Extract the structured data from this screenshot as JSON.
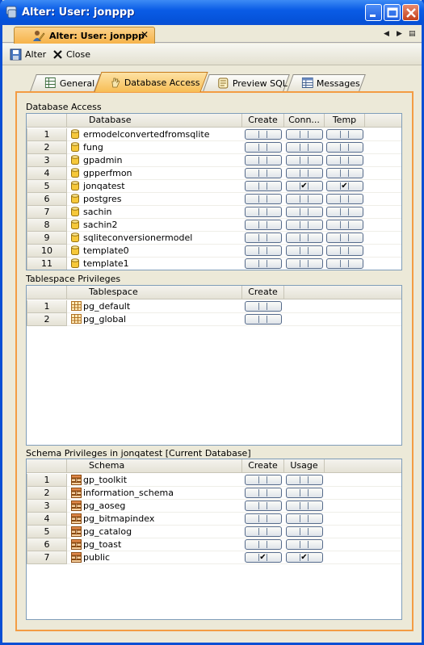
{
  "window": {
    "title": "Alter: User: jonppp"
  },
  "doc_tab": {
    "label": "Alter: User: jonppp",
    "close": "✕"
  },
  "toolbar": {
    "alter_label": "Alter",
    "close_label": "Close"
  },
  "tabs": [
    {
      "label": "General",
      "icon": "grid-icon"
    },
    {
      "label": "Database Access",
      "icon": "hand-icon",
      "active": true
    },
    {
      "label": "Preview SQL",
      "icon": "script-icon"
    },
    {
      "label": "Messages",
      "icon": "table-icon"
    }
  ],
  "database_access": {
    "title": "Database Access",
    "columns": [
      "Database",
      "Create",
      "Conn...",
      "Temp"
    ],
    "rows": [
      {
        "num": "1",
        "name": "ermodelconvertedfromsqlite",
        "create": false,
        "conn": false,
        "temp": false
      },
      {
        "num": "2",
        "name": "fung",
        "create": false,
        "conn": false,
        "temp": false
      },
      {
        "num": "3",
        "name": "gpadmin",
        "create": false,
        "conn": false,
        "temp": false
      },
      {
        "num": "4",
        "name": "gpperfmon",
        "create": false,
        "conn": false,
        "temp": false
      },
      {
        "num": "5",
        "name": "jonqatest",
        "create": false,
        "conn": true,
        "temp": true
      },
      {
        "num": "6",
        "name": "postgres",
        "create": false,
        "conn": false,
        "temp": false
      },
      {
        "num": "7",
        "name": "sachin",
        "create": false,
        "conn": false,
        "temp": false
      },
      {
        "num": "8",
        "name": "sachin2",
        "create": false,
        "conn": false,
        "temp": false
      },
      {
        "num": "9",
        "name": "sqliteconversionermodel",
        "create": false,
        "conn": false,
        "temp": false
      },
      {
        "num": "10",
        "name": "template0",
        "create": false,
        "conn": false,
        "temp": false
      },
      {
        "num": "11",
        "name": "template1",
        "create": false,
        "conn": false,
        "temp": false
      }
    ]
  },
  "tablespace_privileges": {
    "title": "Tablespace Privileges",
    "columns": [
      "Tablespace",
      "Create"
    ],
    "rows": [
      {
        "num": "1",
        "name": "pg_default",
        "create": false
      },
      {
        "num": "2",
        "name": "pg_global",
        "create": false
      }
    ]
  },
  "schema_privileges": {
    "title": "Schema Privileges in jonqatest [Current Database]",
    "columns": [
      "Schema",
      "Create",
      "Usage"
    ],
    "rows": [
      {
        "num": "1",
        "name": "gp_toolkit",
        "create": false,
        "usage": false
      },
      {
        "num": "2",
        "name": "information_schema",
        "create": false,
        "usage": false
      },
      {
        "num": "3",
        "name": "pg_aoseg",
        "create": false,
        "usage": false
      },
      {
        "num": "4",
        "name": "pg_bitmapindex",
        "create": false,
        "usage": false
      },
      {
        "num": "5",
        "name": "pg_catalog",
        "create": false,
        "usage": false
      },
      {
        "num": "6",
        "name": "pg_toast",
        "create": false,
        "usage": false
      },
      {
        "num": "7",
        "name": "public",
        "create": true,
        "usage": true
      }
    ]
  },
  "check_mark": "✔"
}
